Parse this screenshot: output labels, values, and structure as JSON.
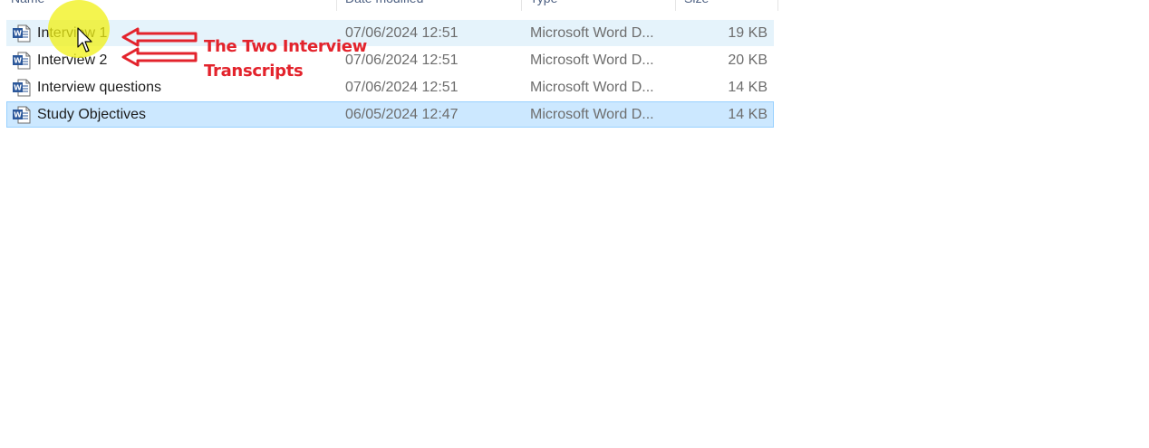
{
  "columns": [
    {
      "label": "Name"
    },
    {
      "label": "Date modified"
    },
    {
      "label": "Type"
    },
    {
      "label": "Size"
    }
  ],
  "files": [
    {
      "name": "Interview 1",
      "date": "07/06/2024 12:51",
      "type": "Microsoft Word D...",
      "size": "19 KB",
      "state": "hover"
    },
    {
      "name": "Interview 2",
      "date": "07/06/2024 12:51",
      "type": "Microsoft Word D...",
      "size": "20 KB",
      "state": "normal"
    },
    {
      "name": "Interview questions",
      "date": "07/06/2024 12:51",
      "type": "Microsoft Word D...",
      "size": "14 KB",
      "state": "normal"
    },
    {
      "name": "Study Objectives",
      "date": "06/05/2024 12:47",
      "type": "Microsoft Word D...",
      "size": "14 KB",
      "state": "selected"
    }
  ],
  "annotation": {
    "line1": "The Two Interview",
    "line2": "Transcripts",
    "color": "#e3232c"
  },
  "icons": {
    "file": "word-document-icon",
    "cursor": "mouse-pointer-icon"
  },
  "colors": {
    "hover_row": "#e5f3fb",
    "selected_row": "#cce8ff",
    "selected_border": "#99d1ff",
    "word_blue": "#2b579a"
  }
}
